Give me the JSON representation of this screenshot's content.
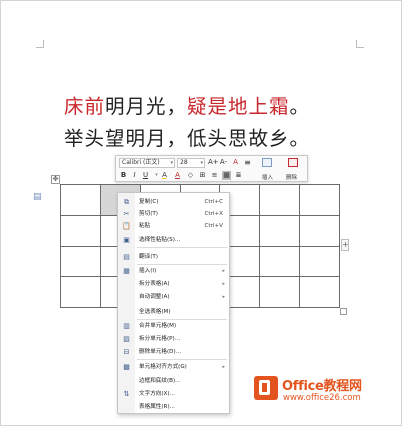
{
  "document": {
    "poem_line1_red_a": "床前",
    "poem_line1_black_a": "明月光，",
    "poem_line1_red_b": "疑是地上霜",
    "poem_line1_black_b": "。",
    "poem_line2": "举头望明月，低头思故乡。",
    "accent_red": "#c8282d"
  },
  "table": {
    "rows": 4,
    "cols": 7,
    "selected_cells": [
      [
        0,
        1
      ]
    ],
    "add_column_glyph": "+"
  },
  "mini_toolbar": {
    "font_name": "Calibri (正文)",
    "font_size": "28",
    "grow_font_label": "A+",
    "shrink_font_label": "A-",
    "format_painter_label": "A",
    "bold_label": "B",
    "italic_label": "I",
    "underline_label": "U",
    "font_color_label": "A",
    "highlight_label": "A",
    "insert_label": "插入",
    "delete_label": "删除"
  },
  "context_menu": {
    "items": [
      {
        "icon": "copy-icon",
        "label": "复制(C)",
        "shortcut": "Ctrl+C",
        "submenu": false
      },
      {
        "icon": "cut-icon",
        "label": "剪切(T)",
        "shortcut": "Ctrl+X",
        "submenu": false
      },
      {
        "icon": "paste-icon",
        "label": "粘贴",
        "shortcut": "Ctrl+V",
        "submenu": false
      },
      {
        "icon": "paste-special-icon",
        "label": "选择性粘贴(S)...",
        "shortcut": "",
        "submenu": false
      },
      {
        "icon": "translate-icon",
        "label": "翻译(T)",
        "shortcut": "",
        "submenu": false
      },
      {
        "icon": "insert-icon",
        "label": "插入(I)",
        "shortcut": "",
        "submenu": true
      },
      {
        "icon": "",
        "label": "拆分表格(A)",
        "shortcut": "",
        "submenu": true
      },
      {
        "icon": "",
        "label": "自动调整(A)",
        "shortcut": "",
        "submenu": true
      },
      {
        "icon": "",
        "label": "全选表格(M)",
        "shortcut": "",
        "submenu": false
      },
      {
        "icon": "merge-cells-icon",
        "label": "合并单元格(M)",
        "shortcut": "",
        "submenu": false
      },
      {
        "icon": "split-cells-icon",
        "label": "拆分单元格(P)...",
        "shortcut": "",
        "submenu": false
      },
      {
        "icon": "delete-cells-icon",
        "label": "删除单元格(D)...",
        "shortcut": "",
        "submenu": false
      },
      {
        "icon": "cell-align-icon",
        "label": "单元格对齐方式(G)",
        "shortcut": "",
        "submenu": true
      },
      {
        "icon": "",
        "label": "边框和底纹(B)...",
        "shortcut": "",
        "submenu": false
      },
      {
        "icon": "text-direction-icon",
        "label": "文字方向(X)...",
        "shortcut": "",
        "submenu": false
      },
      {
        "icon": "",
        "label": "表格属性(R)...",
        "shortcut": "",
        "submenu": false
      }
    ]
  },
  "watermark": {
    "title": "Office教程网",
    "url": "www.office26.com",
    "brand_color": "#e3541e"
  }
}
